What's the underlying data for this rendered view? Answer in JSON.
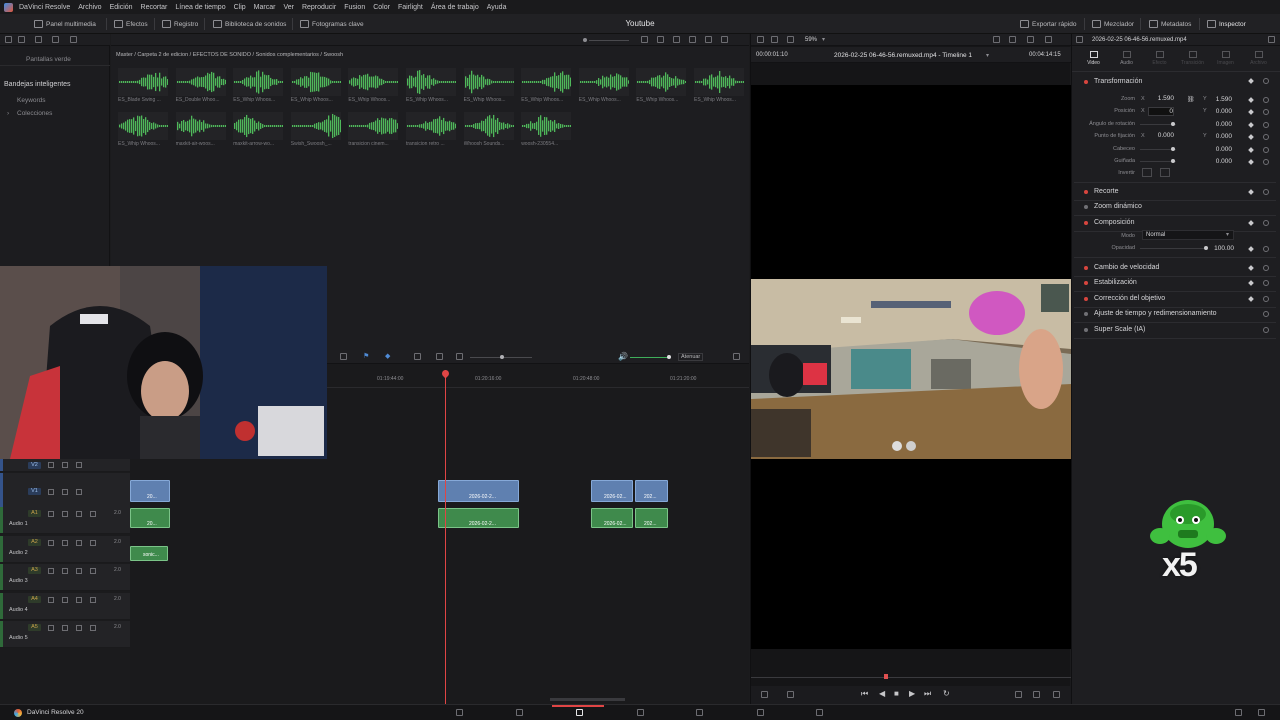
{
  "menu": {
    "app": "DaVinci Resolve",
    "items": [
      "Archivo",
      "Edición",
      "Recortar",
      "Línea de tiempo",
      "Clip",
      "Marcar",
      "Ver",
      "Reproducir",
      "Fusion",
      "Color",
      "Fairlight",
      "Área de trabajo",
      "Ayuda"
    ]
  },
  "toolbar": {
    "media_pool": "Panel multimedia",
    "effects": "Efectos",
    "index": "Registro",
    "sound_library": "Biblioteca de sonidos",
    "keyframes": "Fotogramas clave",
    "project_title": "Youtube",
    "quick_export": "Exportar rápido",
    "mixer": "Mezclador",
    "metadata": "Metadatos",
    "inspector": "Inspector"
  },
  "media_pool": {
    "power_bins": "Pantallas verde",
    "smart_bins": "Bandejas inteligentes",
    "keywords": "Keywords",
    "collections": "Colecciones",
    "breadcrumb": "Master / Carpeta 2 de edicion / EFECTOS DE SONIDO / Sonidos complementarios / Swoosh",
    "clips": [
      "ES_Blade Swing ...",
      "ES_Double Whoo...",
      "ES_Whip Whoos...",
      "ES_Whip Whoos...",
      "ES_Whip Whoos...",
      "ES_Whip Whoos...",
      "ES_Whip Whoos...",
      "ES_Whip Whoos...",
      "ES_Whip Whoos...",
      "ES_Whip Whoos...",
      "ES_Whip Whoos...",
      "ES_Whip Whoos...",
      "maxkit-air-woos...",
      "maxkit-arrow-wo...",
      "Swish_Swoosh_...",
      "transicion cinem...",
      "transicion retro ...",
      "Whoosh Sounds...",
      "woosh-230554..."
    ]
  },
  "viewer": {
    "zoom": "59%",
    "timecode_left": "00:00:01:10",
    "clip_title": "2026-02-25 06-46-56.remuxed.mp4 - Timeline 1",
    "timecode_right": "00:04:14:15"
  },
  "timeline": {
    "ruler": [
      "01:19:44:00",
      "01:20:16:00",
      "01:20:48:00",
      "01:21:20:00"
    ],
    "mute_label": "Atenuar",
    "tracks": [
      {
        "tag": "V2",
        "name": ""
      },
      {
        "tag": "V1",
        "name": ""
      },
      {
        "tag": "A1",
        "name": "Audio 1",
        "level": "2.0"
      },
      {
        "tag": "A2",
        "name": "Audio 2",
        "level": "2.0"
      },
      {
        "tag": "A3",
        "name": "Audio 3",
        "level": "2.0"
      },
      {
        "tag": "A4",
        "name": "Audio 4",
        "level": "2.0"
      },
      {
        "tag": "A5",
        "name": "Audio 5",
        "level": "2.0"
      }
    ],
    "clips": {
      "v1_a": "20...",
      "v1_b": "2026-02-2...",
      "v1_c": "2026-02...",
      "v1_d": "202...",
      "a1_a": "20...",
      "a1_b": "2026-02-2...",
      "a1_c": "2026-02...",
      "a1_d": "202...",
      "a2_a": "sonic..."
    }
  },
  "inspector": {
    "clip_name": "2026-02-25 06-46-56.remuxed.mp4",
    "tabs": [
      "Video",
      "Audio",
      "Efecto",
      "Transición",
      "Imagen",
      "Archivo"
    ],
    "transform": "Transformación",
    "zoom_label": "Zoom",
    "zoom_x": "1.590",
    "zoom_y": "1.590",
    "position_label": "Posición",
    "position_x": "0",
    "position_y": "0.000",
    "rotation_label": "Ángulo de rotación",
    "rotation_val": "0.000",
    "anchor_label": "Punto de fijación",
    "anchor_x": "0.000",
    "anchor_y": "0.000",
    "pitch_label": "Cabeceo",
    "pitch_val": "0.000",
    "yaw_label": "Guiñada",
    "yaw_val": "0.000",
    "flip_label": "Invertir",
    "axis_x": "X",
    "axis_y": "Y",
    "sections": [
      "Recorte",
      "Zoom dinámico",
      "Composición"
    ],
    "mode_label": "Modo",
    "mode_val": "Normal",
    "opacity_label": "Opacidad",
    "opacity_val": "100.00",
    "more_sections": [
      "Cambio de velocidad",
      "Estabilización",
      "Corrección del objetivo",
      "Ajuste de tiempo y redimensionamiento",
      "Super Scale (IA)"
    ]
  },
  "overlay": {
    "badge": "x5"
  },
  "status": {
    "app": "DaVinci Resolve 20"
  }
}
